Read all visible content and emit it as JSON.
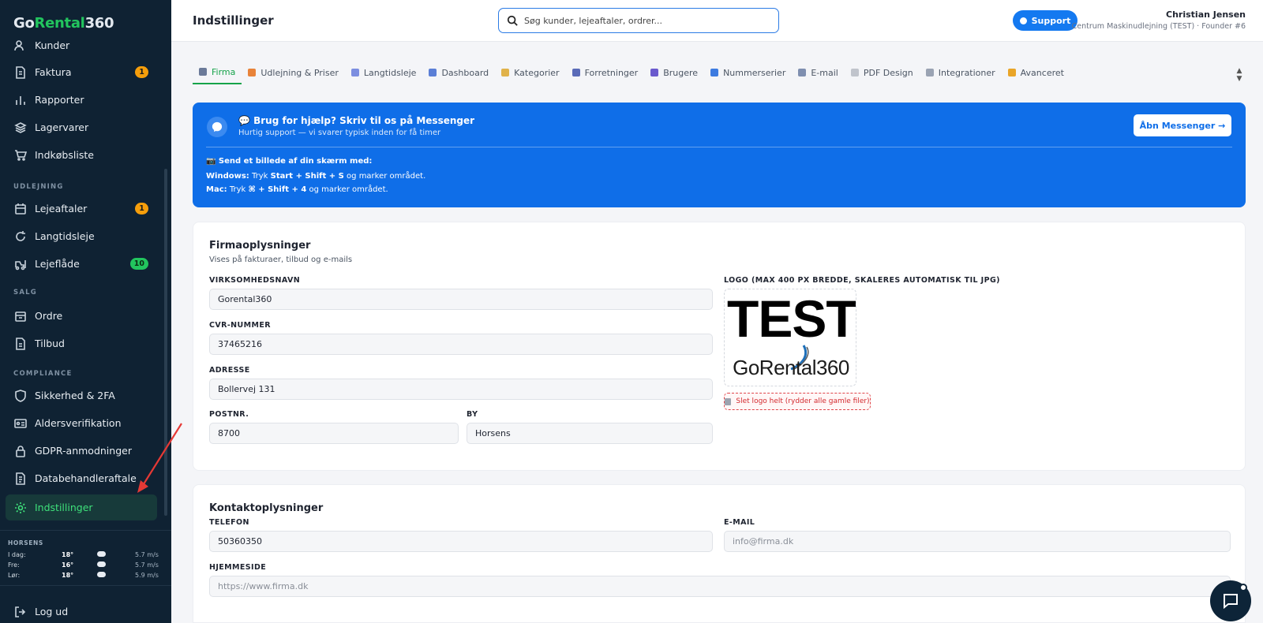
{
  "brand": {
    "part1": "Go",
    "part2": "Rental",
    "part3": "360"
  },
  "sidebar": {
    "items": [
      {
        "label": "Kunder",
        "icon": "users-icon"
      },
      {
        "label": "Faktura",
        "icon": "invoice-icon",
        "badge": "1"
      },
      {
        "label": "Rapporter",
        "icon": "bar-chart-icon"
      },
      {
        "label": "Lagervarer",
        "icon": "layers-icon"
      },
      {
        "label": "Indkøbsliste",
        "icon": "cart-icon"
      },
      {
        "label": "Lejeaftaler",
        "icon": "calendar-icon",
        "badge": "1"
      },
      {
        "label": "Langtidsleje",
        "icon": "refresh-icon"
      },
      {
        "label": "Lejeflåde",
        "icon": "forklift-icon",
        "badge": "10"
      },
      {
        "label": "Ordre",
        "icon": "box-icon"
      },
      {
        "label": "Tilbud",
        "icon": "document-icon"
      },
      {
        "label": "Sikkerhed & 2FA",
        "icon": "shield-icon"
      },
      {
        "label": "Aldersverifikation",
        "icon": "id-card-icon"
      },
      {
        "label": "GDPR-anmodninger",
        "icon": "lock-icon"
      },
      {
        "label": "Databehandleraftale",
        "icon": "file-text-icon"
      },
      {
        "label": "Indstillinger",
        "icon": "gear-icon"
      },
      {
        "label": "Log ud",
        "icon": "logout-icon"
      }
    ],
    "sections": {
      "udlejning": "UDLEJNING",
      "salg": "SALG",
      "compliance": "COMPLIANCE"
    },
    "weather": {
      "city": "HORSENS",
      "rows": [
        {
          "day": "I dag:",
          "temp": "18°",
          "wind": "5.7 m/s"
        },
        {
          "day": "Fre:",
          "temp": "16°",
          "wind": "5.7 m/s"
        },
        {
          "day": "Lør:",
          "temp": "18°",
          "wind": "5.9 m/s"
        }
      ]
    }
  },
  "header": {
    "title": "Indstillinger",
    "search_placeholder": "Søg kunder, lejeaftaler, ordrer...",
    "support_label": "Support",
    "user_name": "Christian Jensen",
    "user_org": "Centrum Maskinudlejning (TEST) · Founder #6"
  },
  "tabs": [
    {
      "label": "Firma",
      "color": "#6b7a99"
    },
    {
      "label": "Udlejning & Priser",
      "color": "#e8833a"
    },
    {
      "label": "Langtidsleje",
      "color": "#7c8ee0"
    },
    {
      "label": "Dashboard",
      "color": "#5b7fd6"
    },
    {
      "label": "Kategorier",
      "color": "#e0b24a"
    },
    {
      "label": "Forretninger",
      "color": "#5a6bb8"
    },
    {
      "label": "Brugere",
      "color": "#6a5acd"
    },
    {
      "label": "Nummerserier",
      "color": "#3d7be0"
    },
    {
      "label": "E-mail",
      "color": "#7f8fb0"
    },
    {
      "label": "PDF Design",
      "color": "#c0c4cc"
    },
    {
      "label": "Integrationer",
      "color": "#9aa3b3"
    },
    {
      "label": "Avanceret",
      "color": "#e9a528"
    }
  ],
  "tabs_scroll_glyph": "▲\n▼",
  "banner": {
    "title": "💬 Brug for hjælp? Skriv til os på Messenger",
    "subtitle": "Hurtig support — vi svarer typisk inden for få timer",
    "button": "Åbn Messenger →",
    "send_title": "📷 Send et billede af din skærm med:",
    "win_prefix": "Windows:",
    "win_text": "Tryk",
    "win_keys": "Start + Shift + S",
    "win_suffix": "og marker området.",
    "mac_prefix": "Mac:",
    "mac_text": "Tryk",
    "mac_keys": "⌘ + Shift + 4",
    "mac_suffix": "og marker området."
  },
  "firm": {
    "title": "Firmaoplysninger",
    "subtitle": "Vises på fakturaer, tilbud og e-mails",
    "name_label": "VIRKSOMHEDSNAVN",
    "name_value": "Gorental360",
    "cvr_label": "CVR-NUMMER",
    "cvr_value": "37465216",
    "address_label": "ADRESSE",
    "address_value": "Bollervej 131",
    "zip_label": "POSTNR.",
    "zip_value": "8700",
    "city_label": "BY",
    "city_value": "Horsens",
    "logo_label": "LOGO (MAX 400 PX BREDDE, SKALERES AUTOMATISK TIL JPG)",
    "logo_text_top": "TEST",
    "logo_text_bottom": "GoRental360",
    "delete_logo": "Slet logo helt (rydder alle gamle filer)"
  },
  "contact": {
    "title": "Kontaktoplysninger",
    "phone_label": "TELEFON",
    "phone_value": "50360350",
    "email_label": "E-MAIL",
    "email_placeholder": "info@firma.dk",
    "web_label": "HJEMMESIDE",
    "web_placeholder": "https://www.firma.dk"
  },
  "colors": {
    "accent_green": "#22c55e",
    "primary_blue": "#0f6ee8",
    "sidebar_bg": "#0f2233"
  }
}
